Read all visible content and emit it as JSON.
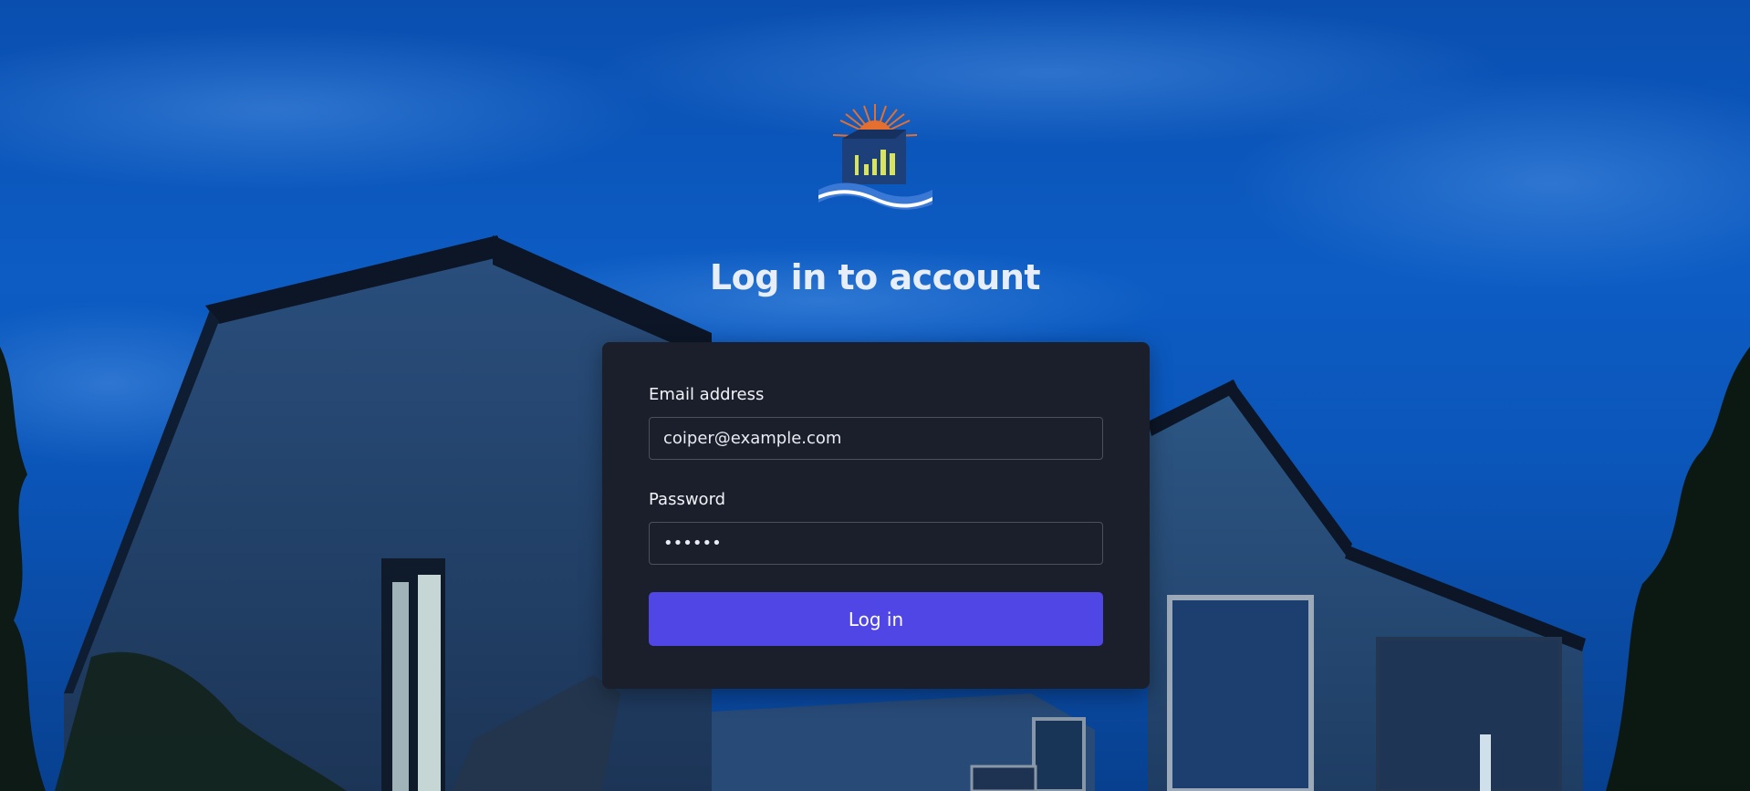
{
  "page": {
    "title": "Log in to account"
  },
  "form": {
    "email_label": "Email address",
    "email_value": "coiper@example.com",
    "password_label": "Password",
    "password_value": "••••••",
    "submit_label": "Log in"
  },
  "colors": {
    "accent": "#4f46e5",
    "card_background": "#1b1f2b",
    "sky": "#0c5cc4",
    "logo_sun": "#e46f2e",
    "logo_house": "#1d3f7a",
    "logo_windows": "#d9e45a",
    "logo_water": "#3a78d6"
  },
  "icons": {
    "logo": "house-sunrise-waves-logo"
  }
}
